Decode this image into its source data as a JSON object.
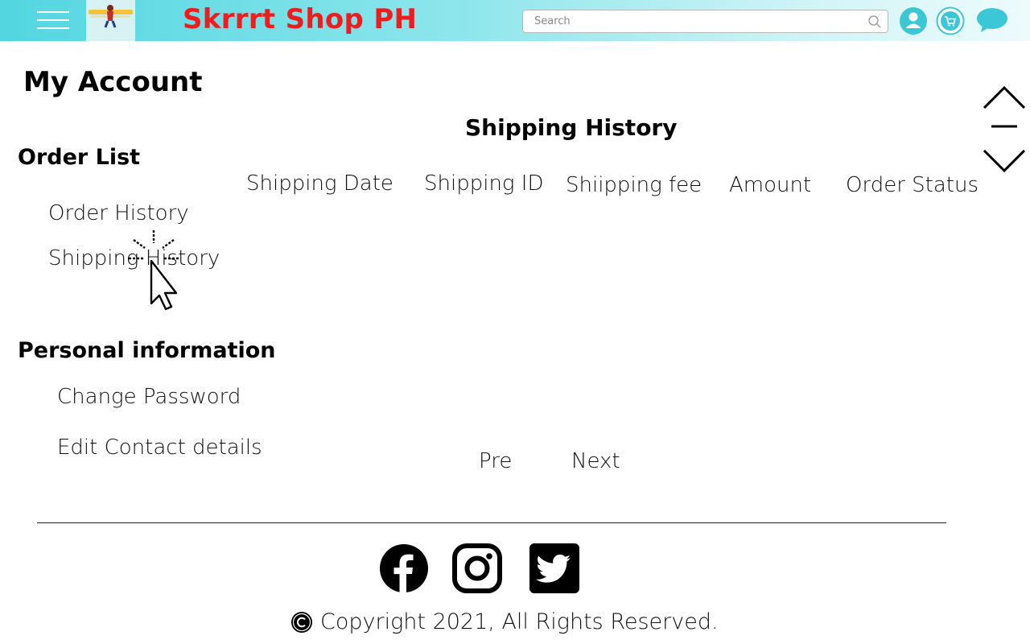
{
  "header": {
    "brand": "Skrrrt Shop PH",
    "search_placeholder": "Search",
    "accent_gradient_start": "#52d6e0",
    "brand_color": "#ee1c1c",
    "icons": [
      "menu-icon",
      "logo",
      "search-icon",
      "user-icon",
      "cart-icon",
      "chat-icon"
    ]
  },
  "sidebar": {
    "page_title": "My Account",
    "order_section": {
      "title": "Order List",
      "items": [
        "Order History",
        "Shipping History"
      ]
    },
    "personal_section": {
      "title": "Personal information",
      "items": [
        "Change Password",
        "Edit Contact details"
      ]
    }
  },
  "main": {
    "title": "Shipping History",
    "columns": [
      "Shipping Date",
      "Shipping ID",
      "Shiipping fee",
      "Amount",
      "Order Status"
    ],
    "rows": [],
    "pager": {
      "prev": "Pre",
      "next": "Next"
    }
  },
  "scroll_nav": {
    "icons": [
      "chevron-up-icon",
      "minus-icon",
      "chevron-down-icon"
    ]
  },
  "footer": {
    "social": [
      "facebook-icon",
      "instagram-icon",
      "twitter-icon"
    ],
    "copyright": "Copyright 2021, All Rights Reserved."
  }
}
